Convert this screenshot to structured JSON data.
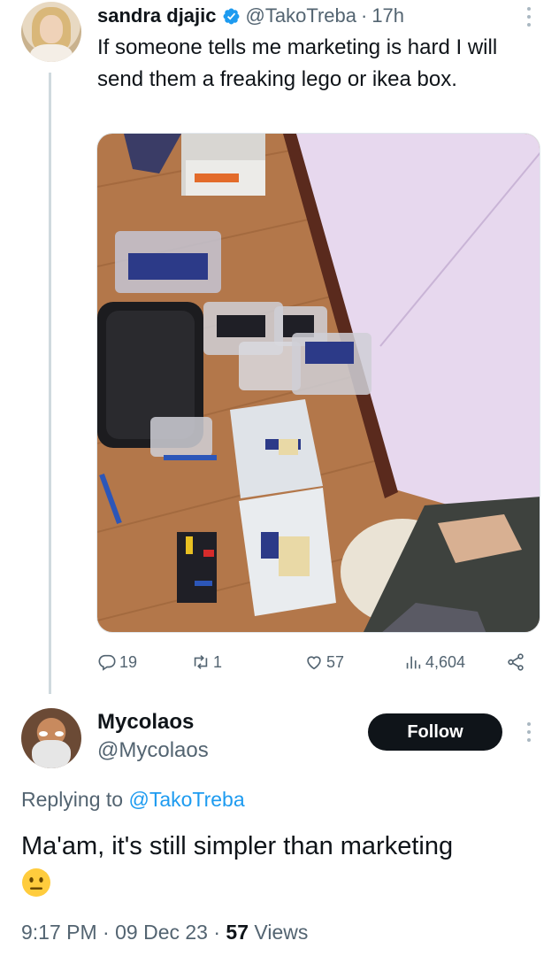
{
  "tweet": {
    "author_name": "sandra djajic",
    "author_handle": "@TakoTreba",
    "separator": "·",
    "time_ago": "17h",
    "text": "If someone tells me marketing is hard I will send them a freaking lego or ikea box.",
    "stats": {
      "replies": "19",
      "retweets": "1",
      "likes": "57",
      "views": "4,604"
    }
  },
  "reply": {
    "author_name": "Mycolaos",
    "author_handle": "@Mycolaos",
    "follow_label": "Follow",
    "replying_prefix": "Replying to",
    "replying_mention": "@TakoTreba",
    "text": "Ma'am, it's still simpler than marketing",
    "emoji": "neutral-face",
    "time": "9:17 PM",
    "separator": "·",
    "date": "09 Dec 23",
    "views_count": "57",
    "views_label": "Views"
  },
  "icons": {
    "verified": "verified-badge-icon",
    "reply": "reply-icon",
    "retweet": "retweet-icon",
    "like": "heart-icon",
    "views": "bar-chart-icon",
    "share": "share-icon",
    "more": "more-options-icon"
  },
  "colors": {
    "accent": "#1d9bf0",
    "text_primary": "#0f1419",
    "text_secondary": "#536471",
    "thread_line": "#cfd9de",
    "follow_bg": "#0f1419"
  }
}
